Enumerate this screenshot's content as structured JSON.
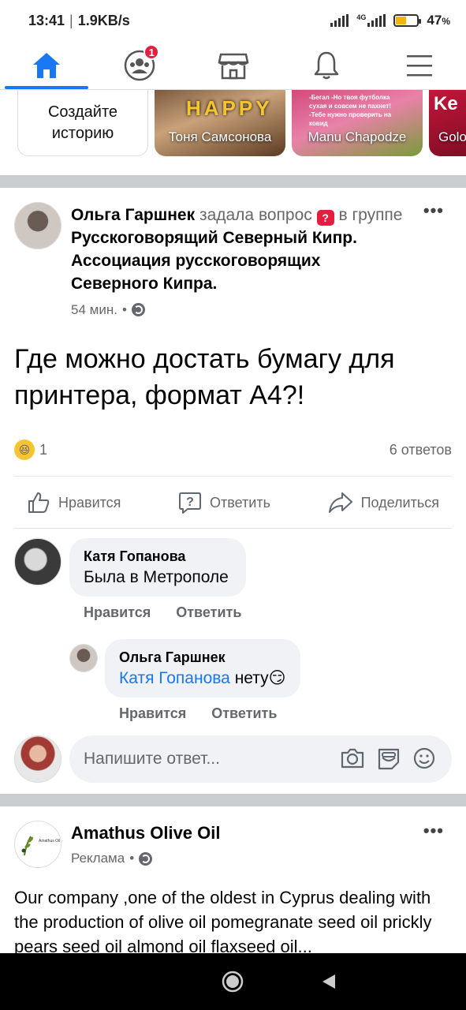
{
  "status_bar": {
    "time": "13:41",
    "net_speed": "1.9KB/s",
    "battery_percent": "47",
    "battery_level": 0.47,
    "network_label": "4G"
  },
  "nav": {
    "tabs": [
      {
        "name": "home-icon",
        "active": true
      },
      {
        "name": "groups-icon",
        "badge": "1"
      },
      {
        "name": "marketplace-icon"
      },
      {
        "name": "bell-icon"
      },
      {
        "name": "menu-icon"
      }
    ]
  },
  "stories": {
    "create_label": "Создайте историю",
    "items": [
      {
        "name": "Тоня Самсонова",
        "overlay": "HAPPY"
      },
      {
        "name": "Manu Chapodze",
        "overlay": "-Бегал -Но твоя футболка сухая и совсем не пахнет! -Тебе нужно проверить на ковид"
      },
      {
        "name": "Golo",
        "overlay": "Ke"
      }
    ]
  },
  "post": {
    "author": "Ольга Гаршнек",
    "action": "задала вопрос",
    "in_group": "в группе",
    "group": "Русскоговорящий Северный Кипр.  Ассоциация русскоговорящих Северного Кипра.",
    "time": "54 мин.",
    "question": "Где можно достать бумагу  для принтера, формат А4?!",
    "reaction_count": "1",
    "answers": "6 ответов",
    "actions": {
      "like": "Нравится",
      "reply": "Ответить",
      "share": "Поделиться"
    }
  },
  "comments": [
    {
      "author": "Катя Гопанова",
      "text": "Была в Метрополе",
      "like": "Нравится",
      "reply": "Ответить"
    },
    {
      "author": "Ольга Гаршнек",
      "mention": "Катя Гопанова",
      "text": "нету😏",
      "like": "Нравится",
      "reply": "Ответить"
    }
  ],
  "reply_box": {
    "placeholder": "Напишите ответ..."
  },
  "ad": {
    "author": "Amathus Olive Oil",
    "label": "Реклама",
    "logo_text": "Amathus Oil",
    "text": "Our company ,one of the oldest in Cyprus dealing with the production of olive oil pomegranate seed oil prickly pears seed oil almond oil flaxseed oil..."
  },
  "colors": {
    "accent": "#1877f2",
    "badge": "#e41e3f",
    "text_secondary": "#65676b",
    "bubble": "#f0f2f5",
    "separator": "#c9ccd1"
  }
}
